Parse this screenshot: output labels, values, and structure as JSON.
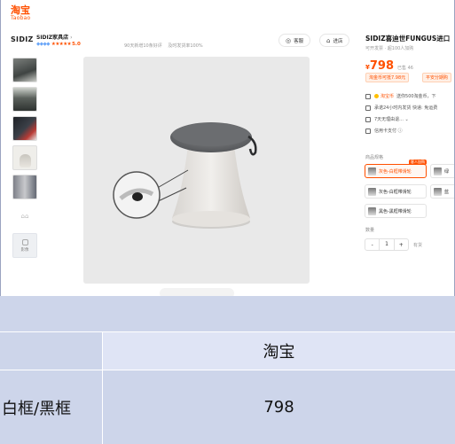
{
  "colors": {
    "accent": "#ff5000",
    "table_bg": "#cdd5ea",
    "table_header_bg": "#dfe4f5"
  },
  "header": {
    "logo_cn": "淘宝",
    "logo_en": "Taobao"
  },
  "store": {
    "logo_text": "SIDIZ",
    "name": "SIDIZ家具店",
    "score_label": "5.0",
    "stats": [
      "90天新增10条好评",
      "及时发货率100%"
    ],
    "service_button": "客服",
    "store_button": "进店"
  },
  "product": {
    "title": "SIDIZ喜迪世FUNGUS进口",
    "subtitle": "可开发票 · 超100人加购",
    "currency": "¥",
    "price": "798",
    "sold": "已售 46",
    "coupons": [
      "淘金币可抵7.98元",
      "平安分期购"
    ],
    "info_rows": [
      {
        "icon": "delivery-icon",
        "brand": "淘宝币",
        "text": "送你500淘金币，下"
      },
      {
        "icon": "guarantee-icon",
        "text": "承诺24小时内发货  快递: 免运费"
      },
      {
        "icon": "return-icon",
        "text": "7天无理由退... ⌄"
      },
      {
        "icon": "card-icon",
        "text": "信用卡支付  ⓘ"
      }
    ],
    "spec_label": "商品规格",
    "options": [
      {
        "label": "灰色-白框带滑轮",
        "tag": "客人加购",
        "selected": true
      },
      {
        "label": "绿",
        "selected": false
      },
      {
        "label": "灰色-白框带滑轮",
        "selected": false
      },
      {
        "label": "蓝",
        "selected": false
      },
      {
        "label": "黑色-黑框带滑轮",
        "selected": false
      }
    ],
    "qty_label": "数量",
    "qty_minus": "-",
    "qty_value": "1",
    "qty_plus": "+",
    "stock": "有货"
  },
  "thumbs": {
    "video_label": "影像"
  },
  "table": {
    "header_left": "",
    "header_right": "淘宝",
    "row_label": "白框/黑框",
    "row_value": "798"
  }
}
